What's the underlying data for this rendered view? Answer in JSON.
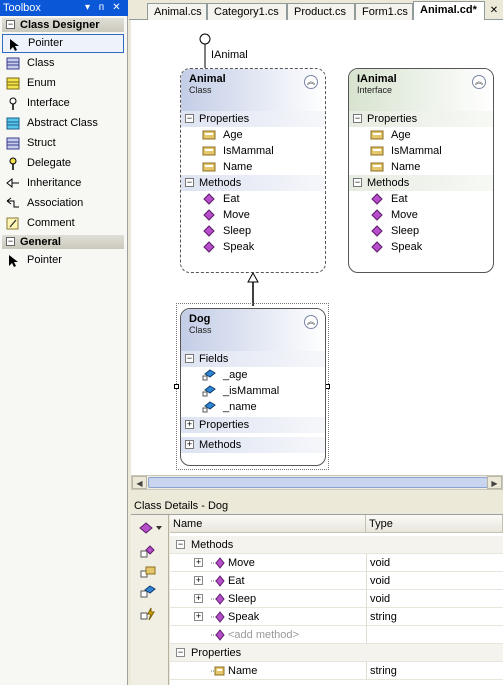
{
  "toolbox": {
    "title": "Toolbox",
    "controls": [
      "▾",
      "ᴨ",
      "✕"
    ],
    "sections": [
      {
        "label": "Class Designer"
      },
      {
        "label": "General"
      }
    ],
    "class_designer_items": [
      {
        "label": "Pointer",
        "icon": "pointer-icon"
      },
      {
        "label": "Class",
        "icon": "class-icon"
      },
      {
        "label": "Enum",
        "icon": "enum-icon"
      },
      {
        "label": "Interface",
        "icon": "interface-icon"
      },
      {
        "label": "Abstract Class",
        "icon": "abstract-class-icon"
      },
      {
        "label": "Struct",
        "icon": "struct-icon"
      },
      {
        "label": "Delegate",
        "icon": "delegate-icon"
      },
      {
        "label": "Inheritance",
        "icon": "inheritance-icon"
      },
      {
        "label": "Association",
        "icon": "association-icon"
      },
      {
        "label": "Comment",
        "icon": "comment-icon"
      }
    ],
    "general_items": [
      {
        "label": "Pointer",
        "icon": "pointer-icon"
      }
    ]
  },
  "tabs": [
    {
      "label": "Animal.cs",
      "active": false
    },
    {
      "label": "Category1.cs",
      "active": false
    },
    {
      "label": "Product.cs",
      "active": false
    },
    {
      "label": "Form1.cs",
      "active": false
    },
    {
      "label": "Animal.cd*",
      "active": true
    }
  ],
  "diagram": {
    "lollipop_label": "IAnimal",
    "animal": {
      "name": "Animal",
      "kind": "Class",
      "properties_label": "Properties",
      "properties": [
        "Age",
        "IsMammal",
        "Name"
      ],
      "methods_label": "Methods",
      "methods": [
        "Eat",
        "Move",
        "Sleep",
        "Speak"
      ]
    },
    "ianimal": {
      "name": "IAnimal",
      "kind": "Interface",
      "properties_label": "Properties",
      "properties": [
        "Age",
        "IsMammal",
        "Name"
      ],
      "methods_label": "Methods",
      "methods": [
        "Eat",
        "Move",
        "Sleep",
        "Speak"
      ]
    },
    "dog": {
      "name": "Dog",
      "kind": "Class",
      "fields_label": "Fields",
      "fields": [
        "_age",
        "_isMammal",
        "_name"
      ],
      "properties_label": "Properties",
      "methods_label": "Methods"
    }
  },
  "details": {
    "title": "Class Details - Dog",
    "columns": {
      "name": "Name",
      "type": "Type"
    },
    "methods_group": "Methods",
    "methods": [
      {
        "name": "Move",
        "type": "void"
      },
      {
        "name": "Eat",
        "type": "void"
      },
      {
        "name": "Sleep",
        "type": "void"
      },
      {
        "name": "Speak",
        "type": "string"
      }
    ],
    "add_method": "<add method>",
    "properties_group": "Properties",
    "properties": [
      {
        "name": "Name",
        "type": "string"
      }
    ]
  },
  "colors": {
    "title_bar": "#0a58d8",
    "class_header": "#c3cde6",
    "interface_header": "#d7e3cf",
    "method_icon": "#b54fc9",
    "property_icon": "#d4b04a"
  }
}
